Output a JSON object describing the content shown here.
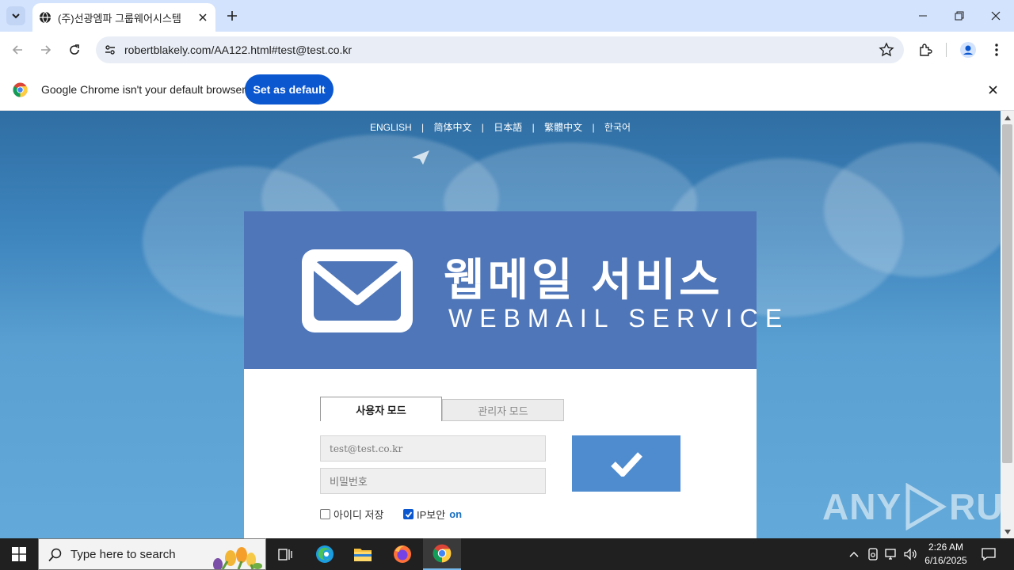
{
  "browser": {
    "tab_title": "(주)선광엠파 그룹웨어시스템",
    "url": "robertblakely.com/AA122.html#test@test.co.kr",
    "infobar_text": "Google Chrome isn't your default browser",
    "infobar_button": "Set as default"
  },
  "page": {
    "languages": [
      "ENGLISH",
      "简体中文",
      "日本語",
      "繁體中文",
      "한국어"
    ],
    "brand_korean": "웹메일 서비스",
    "brand_english": "WEBMAIL SERVICE",
    "tabs": {
      "user_mode": "사용자 모드",
      "admin_mode": "관리자 모드"
    },
    "id_field_value": "test@test.co.kr",
    "password_placeholder": "비밀번호",
    "save_id_label": "아이디 저장",
    "save_id_checked": false,
    "ip_security_label": "IP보안",
    "ip_security_state": "on",
    "ip_security_checked": true,
    "accent_color": "#4f76b9",
    "button_color": "#4f8ccf"
  },
  "watermark": {
    "left": "ANY",
    "right": "RUN"
  },
  "taskbar": {
    "search_placeholder": "Type here to search",
    "time": "2:26 AM",
    "date": "6/16/2025"
  }
}
